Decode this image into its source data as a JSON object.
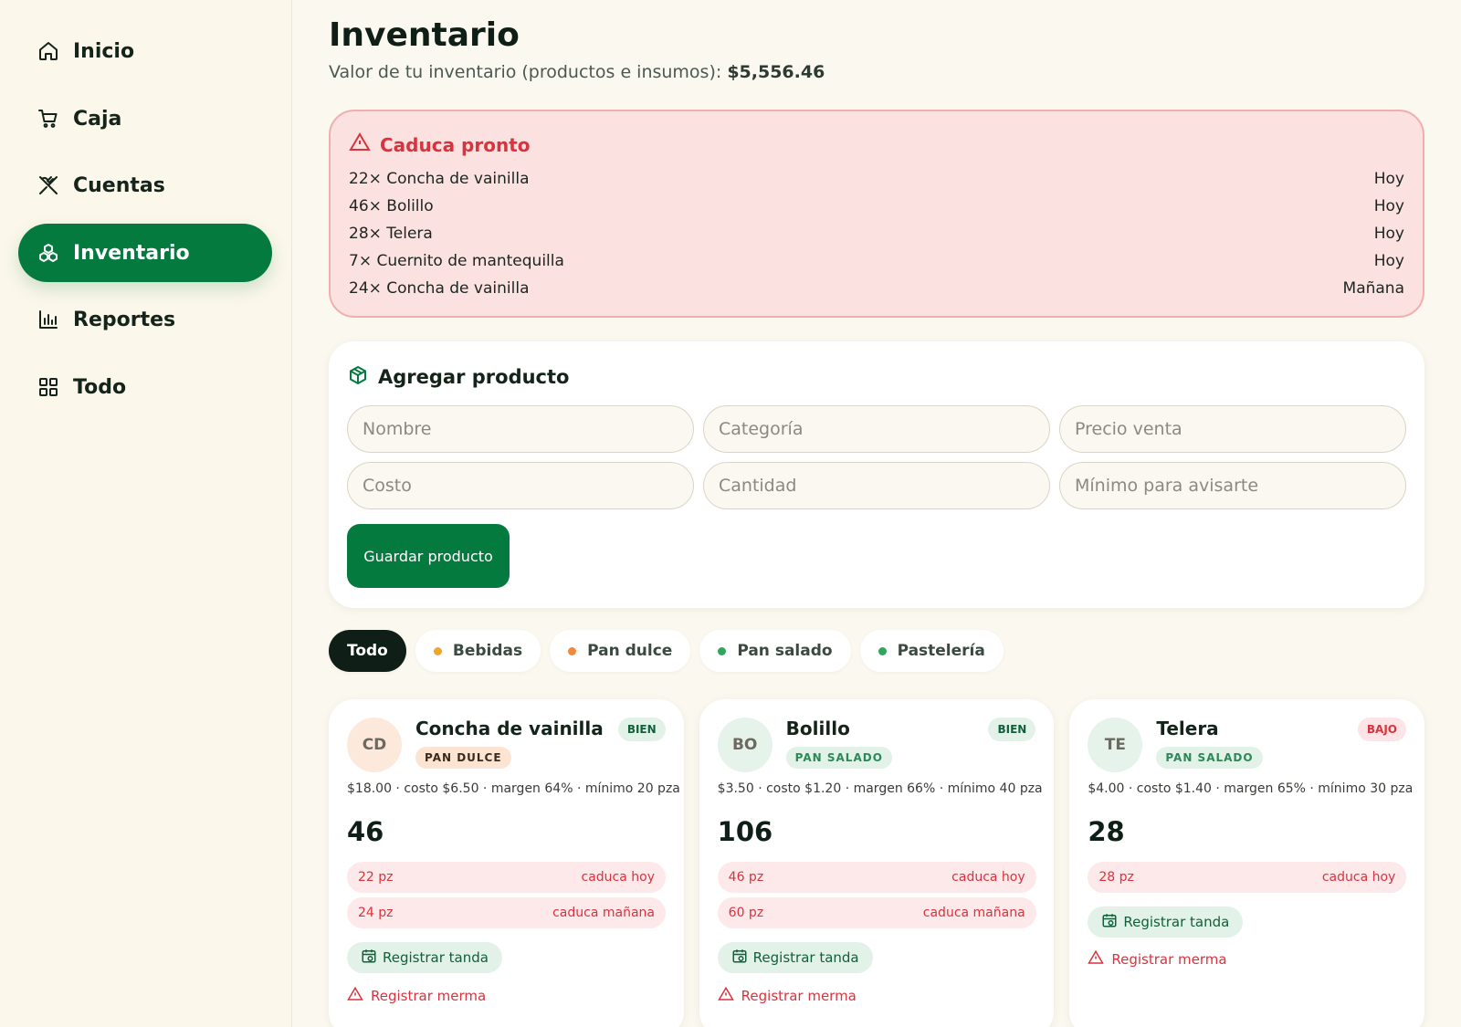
{
  "sidebar": {
    "items": [
      {
        "label": "Inicio",
        "icon": "home-icon"
      },
      {
        "label": "Caja",
        "icon": "cart-icon"
      },
      {
        "label": "Cuentas",
        "icon": "utensils-icon"
      },
      {
        "label": "Inventario",
        "icon": "boxes-icon",
        "active": true
      },
      {
        "label": "Reportes",
        "icon": "bar-chart-icon"
      },
      {
        "label": "Todo",
        "icon": "grid-icon"
      }
    ]
  },
  "header": {
    "title": "Inventario",
    "subtitle_prefix": "Valor de tu inventario (productos e insumos): ",
    "inventory_value": "$5,556.46"
  },
  "alert": {
    "title": "Caduca pronto",
    "icon": "warning-triangle-icon",
    "rows": [
      {
        "item": "22× Concha de vainilla",
        "when": "Hoy"
      },
      {
        "item": "46× Bolillo",
        "when": "Hoy"
      },
      {
        "item": "28× Telera",
        "when": "Hoy"
      },
      {
        "item": "7× Cuernito de mantequilla",
        "when": "Hoy"
      },
      {
        "item": "24× Concha de vainilla",
        "when": "Mañana"
      }
    ]
  },
  "add_product": {
    "title": "Agregar producto",
    "icon": "package-plus-icon",
    "fields": {
      "nombre": "Nombre",
      "categoria": "Categoría",
      "precio_venta": "Precio venta",
      "costo": "Costo",
      "cantidad": "Cantidad",
      "minimo": "Mínimo para avisarte"
    },
    "save_label": "Guardar producto"
  },
  "filters": [
    {
      "label": "Todo",
      "active": true,
      "dot": null
    },
    {
      "label": "Bebidas",
      "dot": "#f2a52c"
    },
    {
      "label": "Pan dulce",
      "dot": "#f08a3a"
    },
    {
      "label": "Pan salado",
      "dot": "#2fa65b"
    },
    {
      "label": "Pastelería",
      "dot": "#2fa65b"
    }
  ],
  "products": [
    {
      "initials": "CD",
      "name": "Concha de vainilla",
      "category": "PAN DULCE",
      "status": "BIEN",
      "meta": "$18.00 · costo $6.50 · margen 64% · mínimo 20 pza",
      "quantity": "46",
      "expirations": [
        {
          "qty": "22 pz",
          "when": "caduca hoy"
        },
        {
          "qty": "24 pz",
          "when": "caduca mañana"
        }
      ],
      "tanda_label": "Registrar tanda",
      "merma_label": "Registrar merma"
    },
    {
      "initials": "BO",
      "name": "Bolillo",
      "category": "PAN SALADO",
      "status": "BIEN",
      "meta": "$3.50 · costo $1.20 · margen 66% · mínimo 40 pza",
      "quantity": "106",
      "expirations": [
        {
          "qty": "46 pz",
          "when": "caduca hoy"
        },
        {
          "qty": "60 pz",
          "when": "caduca mañana"
        }
      ],
      "tanda_label": "Registrar tanda",
      "merma_label": "Registrar merma"
    },
    {
      "initials": "TE",
      "name": "Telera",
      "category": "PAN SALADO",
      "status": "BAJO",
      "meta": "$4.00 · costo $1.40 · margen 65% · mínimo 30 pza",
      "quantity": "28",
      "expirations": [
        {
          "qty": "28 pz",
          "when": "caduca hoy"
        }
      ],
      "tanda_label": "Registrar tanda",
      "merma_label": "Registrar merma"
    }
  ],
  "colors": {
    "accent": "#047a3f",
    "danger": "#d8333e",
    "alert_bg": "#fbe1df",
    "page_bg": "#fbf8ef"
  }
}
